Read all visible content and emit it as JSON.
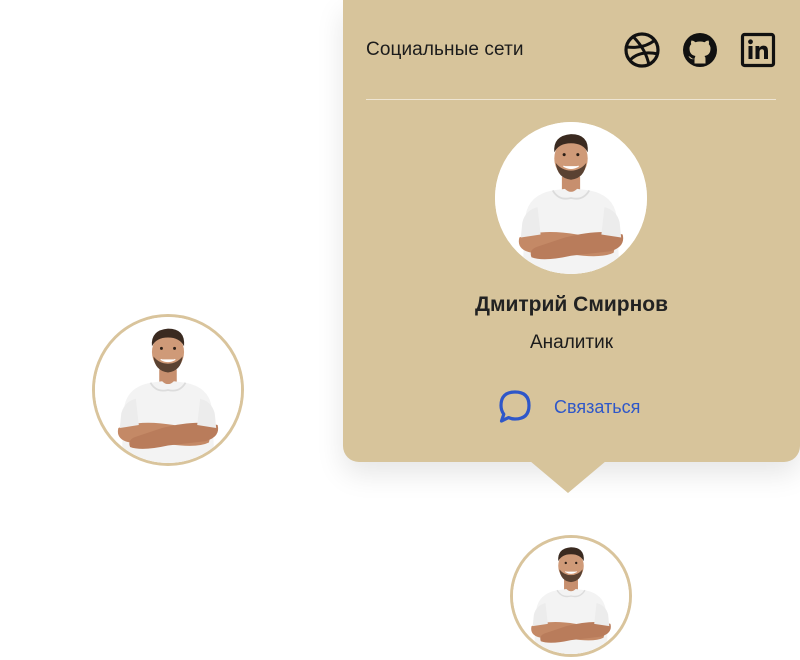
{
  "card": {
    "title": "Социальные сети",
    "social": [
      {
        "icon": "dribbble-icon"
      },
      {
        "icon": "github-icon"
      },
      {
        "icon": "linkedin-icon"
      }
    ],
    "name": "Дмитрий Смирнов",
    "role": "Аналитик",
    "contact_label": "Связаться",
    "contact_icon": "chat-bubble-icon"
  },
  "colors": {
    "card_bg": "#d7c49b",
    "avatar_ring": "#d9c49c",
    "link": "#2e57c9",
    "text": "#1c1c1c"
  }
}
